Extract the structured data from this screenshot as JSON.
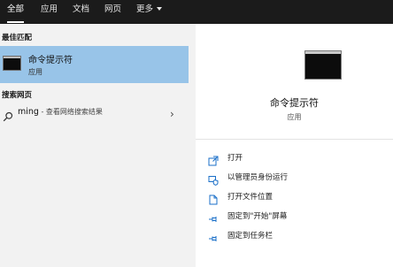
{
  "tabs": [
    {
      "label": "全部"
    },
    {
      "label": "应用"
    },
    {
      "label": "文档"
    },
    {
      "label": "网页"
    },
    {
      "label": "更多"
    }
  ],
  "best_match": {
    "section_title": "最佳匹配",
    "title": "命令提示符",
    "subtitle": "应用",
    "icon": "terminal-icon"
  },
  "web_search": {
    "section_title": "搜索网页",
    "query": "ming",
    "suffix": " - 查看网络搜索结果",
    "icon": "search-icon"
  },
  "detail": {
    "title": "命令提示符",
    "subtitle": "应用",
    "actions": [
      {
        "label": "打开",
        "icon": "open-icon"
      },
      {
        "label": "以管理员身份运行",
        "icon": "run-as-admin-icon"
      },
      {
        "label": "打开文件位置",
        "icon": "file-location-icon"
      },
      {
        "label": "固定到\"开始\"屏幕",
        "icon": "pin-icon"
      },
      {
        "label": "固定到任务栏",
        "icon": "pin-icon"
      }
    ]
  },
  "colors": {
    "topbar": "#1b1b1b",
    "selected_row": "#98c4e8",
    "icon_blue": "#1a6fc8"
  }
}
